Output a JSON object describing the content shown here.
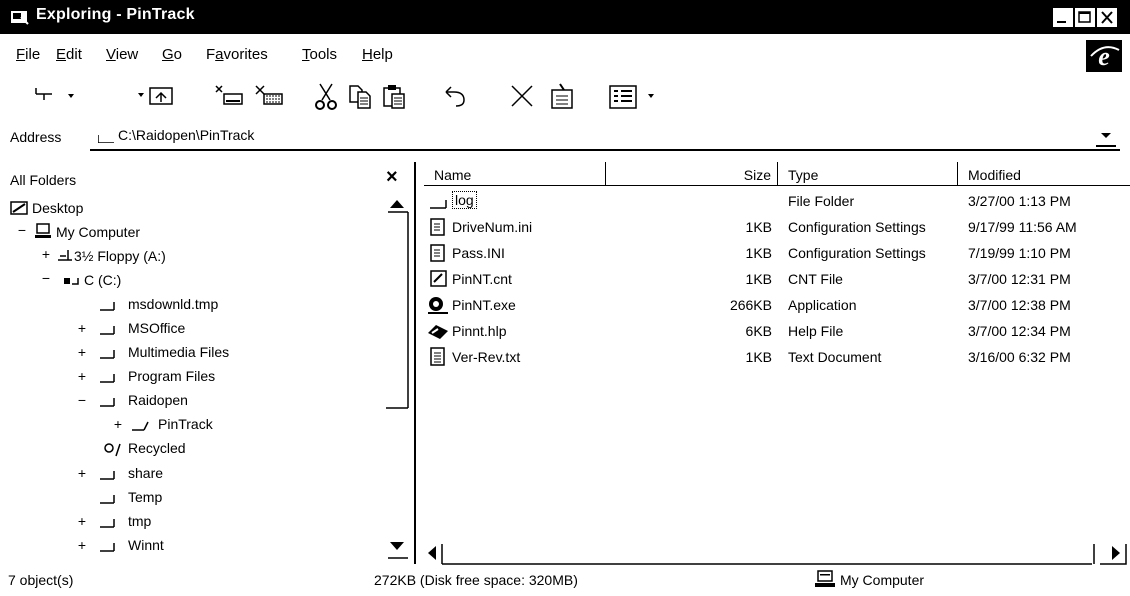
{
  "window": {
    "title": "Exploring - PinTrack",
    "controls": [
      "minimize-icon",
      "maximize-icon",
      "close-icon"
    ]
  },
  "menu": [
    "File",
    "Edit",
    "View",
    "Go",
    "Favorites",
    "Tools",
    "Help"
  ],
  "menu_mnemonic": [
    "F",
    "E",
    "V",
    "G",
    "a",
    "T",
    "H"
  ],
  "toolbar": [
    "back-icon",
    "forward-icon",
    "up-folder-icon",
    "map-drive-icon",
    "disconnect-drive-icon",
    "cut-icon",
    "copy-icon",
    "paste-icon",
    "undo-icon",
    "delete-icon",
    "properties-icon",
    "views-icon"
  ],
  "address": {
    "label": "Address",
    "value": "C:\\Raidopen\\PinTrack"
  },
  "folders": {
    "title": "All Folders",
    "close": "×",
    "tree": [
      {
        "label": "Desktop",
        "expander": "",
        "icon": "desktop-icon"
      },
      {
        "label": "My Computer",
        "expander": "−",
        "icon": "computer-icon"
      },
      {
        "label": "3½ Floppy (A:)",
        "expander": "+",
        "icon": "floppy-icon"
      },
      {
        "label": "C (C:)",
        "expander": "−",
        "icon": "drive-icon"
      },
      {
        "label": "msdownld.tmp",
        "expander": "",
        "icon": "folder-icon"
      },
      {
        "label": "MSOffice",
        "expander": "+",
        "icon": "folder-icon"
      },
      {
        "label": "Multimedia Files",
        "expander": "+",
        "icon": "folder-icon"
      },
      {
        "label": "Program Files",
        "expander": "+",
        "icon": "folder-icon"
      },
      {
        "label": "Raidopen",
        "expander": "−",
        "icon": "folder-icon"
      },
      {
        "label": "PinTrack",
        "expander": "+",
        "icon": "open-folder-icon"
      },
      {
        "label": "Recycled",
        "expander": "",
        "icon": "recycle-icon"
      },
      {
        "label": "share",
        "expander": "+",
        "icon": "folder-icon"
      },
      {
        "label": "Temp",
        "expander": "",
        "icon": "folder-icon"
      },
      {
        "label": "tmp",
        "expander": "+",
        "icon": "folder-icon"
      },
      {
        "label": "Winnt",
        "expander": "+",
        "icon": "folder-icon"
      }
    ]
  },
  "list": {
    "columns": [
      "Name",
      "Size",
      "Type",
      "Modified"
    ],
    "rows": [
      {
        "name": "log",
        "size": "",
        "type": "File Folder",
        "modified": "3/27/00 1:13 PM",
        "icon": "folder-icon"
      },
      {
        "name": "DriveNum.ini",
        "size": "1KB",
        "type": "Configuration Settings",
        "modified": "9/17/99 11:56 AM",
        "icon": "config-file-icon"
      },
      {
        "name": "Pass.INI",
        "size": "1KB",
        "type": "Configuration Settings",
        "modified": "7/19/99 1:10 PM",
        "icon": "config-file-icon"
      },
      {
        "name": "PinNT.cnt",
        "size": "1KB",
        "type": "CNT File",
        "modified": "3/7/00 12:31 PM",
        "icon": "cnt-file-icon"
      },
      {
        "name": "PinNT.exe",
        "size": "266KB",
        "type": "Application",
        "modified": "3/7/00 12:38 PM",
        "icon": "application-icon"
      },
      {
        "name": "Pinnt.hlp",
        "size": "6KB",
        "type": "Help File",
        "modified": "3/7/00 12:34 PM",
        "icon": "help-file-icon"
      },
      {
        "name": "Ver-Rev.txt",
        "size": "1KB",
        "type": "Text Document",
        "modified": "3/16/00 6:32 PM",
        "icon": "text-file-icon"
      }
    ]
  },
  "status": {
    "objects": "7 object(s)",
    "size": "272KB (Disk free space: 320MB)",
    "location": "My Computer"
  }
}
